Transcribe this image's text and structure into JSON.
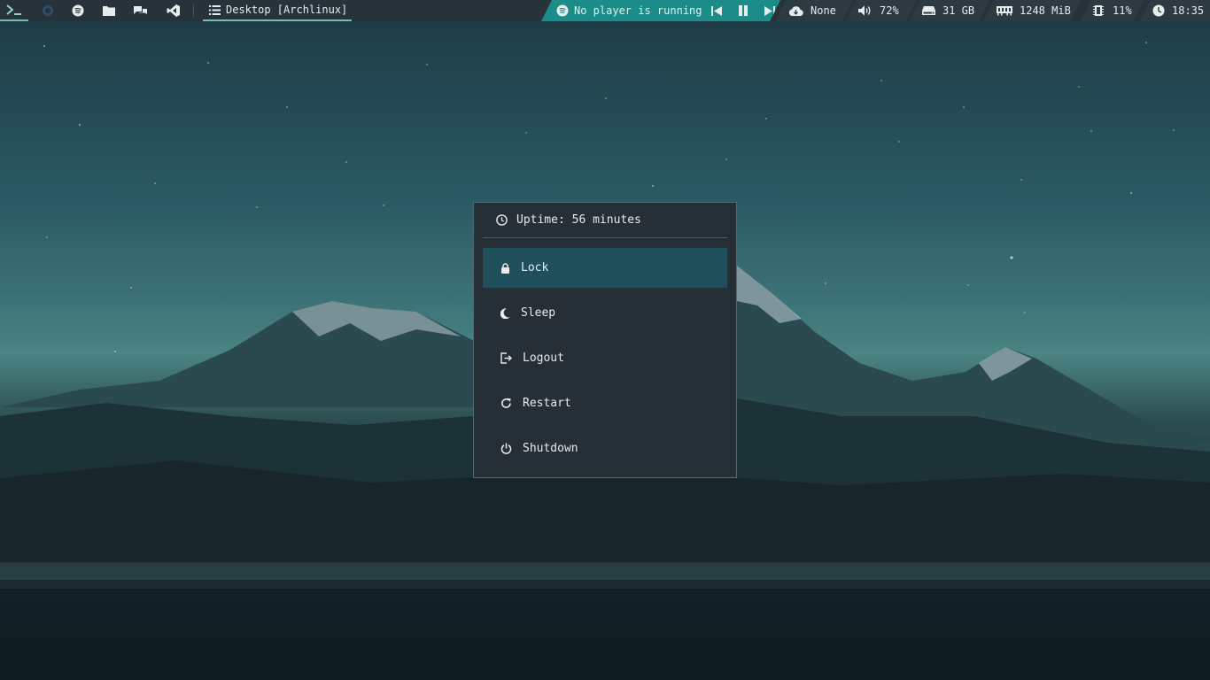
{
  "topbar": {
    "launchers": [
      {
        "icon": "terminal-icon"
      },
      {
        "icon": "firefox-icon"
      },
      {
        "icon": "spotify-icon"
      },
      {
        "icon": "folder-icon"
      },
      {
        "icon": "chat-icon"
      },
      {
        "icon": "vscode-icon"
      }
    ],
    "window_title": "Desktop [Archlinux]",
    "media": {
      "text": "No player is running",
      "controls": [
        "previous-icon",
        "pause-icon",
        "next-icon"
      ]
    },
    "updates": {
      "icon": "cloud-download-icon",
      "value": "None"
    },
    "volume": {
      "icon": "volume-icon",
      "value": "72%"
    },
    "disk": {
      "icon": "disk-icon",
      "value": "31 GB"
    },
    "memory": {
      "icon": "memory-icon",
      "value": "1248 MiB"
    },
    "cpu": {
      "icon": "cpu-icon",
      "value": "11%"
    },
    "clock": {
      "icon": "clock-icon",
      "value": "18:35"
    }
  },
  "power_menu": {
    "uptime": "Uptime: 56 minutes",
    "items": [
      {
        "label": "Lock",
        "icon": "lock-icon"
      },
      {
        "label": "Sleep",
        "icon": "moon-icon"
      },
      {
        "label": "Logout",
        "icon": "logout-icon"
      },
      {
        "label": "Restart",
        "icon": "restart-icon"
      },
      {
        "label": "Shutdown",
        "icon": "power-icon"
      }
    ],
    "selected": "Lock"
  },
  "colors": {
    "bar_bg": "#27323a",
    "accent_teal": "#1b8c87",
    "menu_bg": "#262f36",
    "menu_selected": "#1e4f5b"
  }
}
